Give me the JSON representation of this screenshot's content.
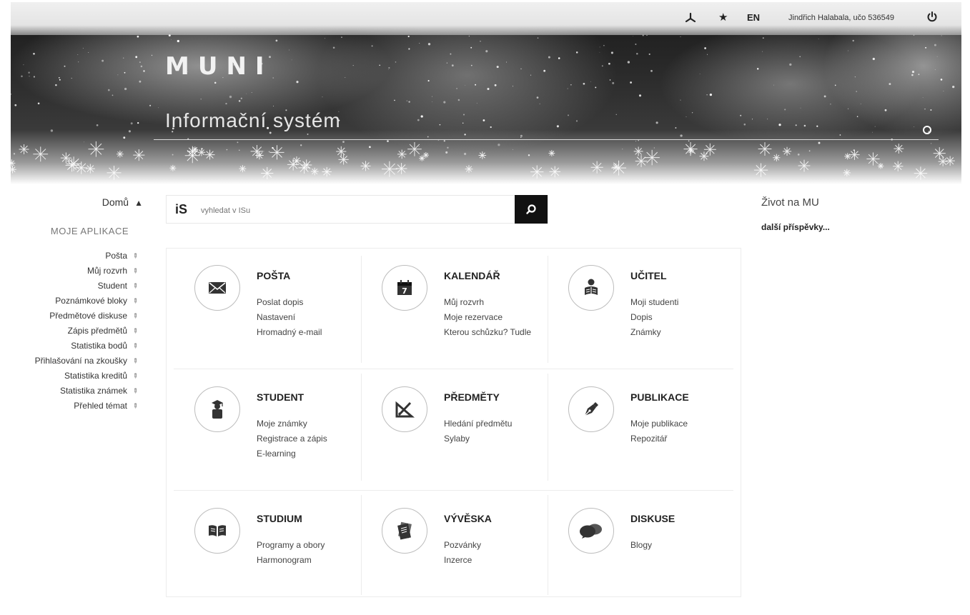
{
  "topbar": {
    "lang": "EN",
    "user": "Jindřich Halabala, učo 536549"
  },
  "brand": {
    "logo": "MUNI",
    "subtitle": "Informační systém"
  },
  "sidebar": {
    "home_label": "Domů",
    "section_title": "MOJE APLIKACE",
    "items": [
      {
        "label": "Pošta"
      },
      {
        "label": "Můj rozvrh"
      },
      {
        "label": "Student"
      },
      {
        "label": "Poznámkové bloky"
      },
      {
        "label": "Předmětové diskuse"
      },
      {
        "label": "Zápis předmětů"
      },
      {
        "label": "Statistika bodů"
      },
      {
        "label": "Přihlašování na zkoušky"
      },
      {
        "label": "Statistika kreditů"
      },
      {
        "label": "Statistika známek"
      },
      {
        "label": "Přehled témat"
      }
    ]
  },
  "search": {
    "logo": "iS",
    "placeholder": "vyhledat v ISu"
  },
  "tiles": [
    {
      "title": "POŠTA",
      "icon": "envelope-icon",
      "links": [
        "Poslat dopis",
        "Nastavení",
        "Hromadný e-mail"
      ]
    },
    {
      "title": "KALENDÁŘ",
      "icon": "calendar-icon",
      "calendar_day": "7",
      "links": [
        "Můj rozvrh",
        "Moje rezervace",
        "Kterou schůzku? Tudle"
      ]
    },
    {
      "title": "UČITEL",
      "icon": "teacher-icon",
      "links": [
        "Moji studenti",
        "Dopis",
        "Známky"
      ]
    },
    {
      "title": "STUDENT",
      "icon": "graduate-icon",
      "links": [
        "Moje známky",
        "Registrace a zápis",
        "E-learning"
      ]
    },
    {
      "title": "PŘEDMĚTY",
      "icon": "geometry-tools-icon",
      "links": [
        "Hledání předmětu",
        "Sylaby"
      ]
    },
    {
      "title": "PUBLIKACE",
      "icon": "fountain-pen-icon",
      "links": [
        "Moje publikace",
        "Repozitář"
      ]
    },
    {
      "title": "STUDIUM",
      "icon": "open-book-icon",
      "links": [
        "Programy a obory",
        "Harmonogram"
      ]
    },
    {
      "title": "VÝVĚSKA",
      "icon": "notice-board-icon",
      "links": [
        "Pozvánky",
        "Inzerce"
      ]
    },
    {
      "title": "DISKUSE",
      "icon": "speech-bubbles-icon",
      "links": [
        "Blogy"
      ]
    }
  ],
  "news": {
    "title": "Život na MU",
    "more": "další příspěvky..."
  }
}
